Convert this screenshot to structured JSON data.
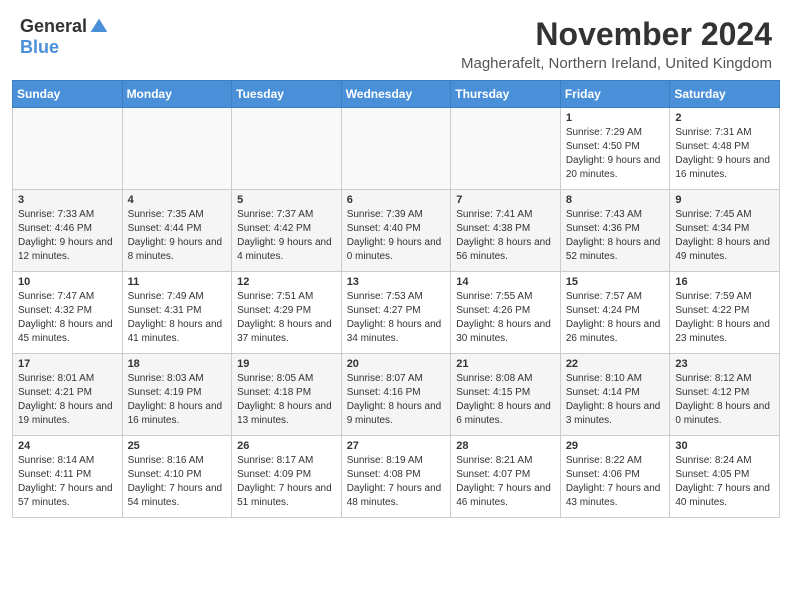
{
  "header": {
    "logo_general": "General",
    "logo_blue": "Blue",
    "month_title": "November 2024",
    "location": "Magherafelt, Northern Ireland, United Kingdom"
  },
  "days_of_week": [
    "Sunday",
    "Monday",
    "Tuesday",
    "Wednesday",
    "Thursday",
    "Friday",
    "Saturday"
  ],
  "weeks": [
    [
      {
        "day": "",
        "info": ""
      },
      {
        "day": "",
        "info": ""
      },
      {
        "day": "",
        "info": ""
      },
      {
        "day": "",
        "info": ""
      },
      {
        "day": "",
        "info": ""
      },
      {
        "day": "1",
        "info": "Sunrise: 7:29 AM\nSunset: 4:50 PM\nDaylight: 9 hours and 20 minutes."
      },
      {
        "day": "2",
        "info": "Sunrise: 7:31 AM\nSunset: 4:48 PM\nDaylight: 9 hours and 16 minutes."
      }
    ],
    [
      {
        "day": "3",
        "info": "Sunrise: 7:33 AM\nSunset: 4:46 PM\nDaylight: 9 hours and 12 minutes."
      },
      {
        "day": "4",
        "info": "Sunrise: 7:35 AM\nSunset: 4:44 PM\nDaylight: 9 hours and 8 minutes."
      },
      {
        "day": "5",
        "info": "Sunrise: 7:37 AM\nSunset: 4:42 PM\nDaylight: 9 hours and 4 minutes."
      },
      {
        "day": "6",
        "info": "Sunrise: 7:39 AM\nSunset: 4:40 PM\nDaylight: 9 hours and 0 minutes."
      },
      {
        "day": "7",
        "info": "Sunrise: 7:41 AM\nSunset: 4:38 PM\nDaylight: 8 hours and 56 minutes."
      },
      {
        "day": "8",
        "info": "Sunrise: 7:43 AM\nSunset: 4:36 PM\nDaylight: 8 hours and 52 minutes."
      },
      {
        "day": "9",
        "info": "Sunrise: 7:45 AM\nSunset: 4:34 PM\nDaylight: 8 hours and 49 minutes."
      }
    ],
    [
      {
        "day": "10",
        "info": "Sunrise: 7:47 AM\nSunset: 4:32 PM\nDaylight: 8 hours and 45 minutes."
      },
      {
        "day": "11",
        "info": "Sunrise: 7:49 AM\nSunset: 4:31 PM\nDaylight: 8 hours and 41 minutes."
      },
      {
        "day": "12",
        "info": "Sunrise: 7:51 AM\nSunset: 4:29 PM\nDaylight: 8 hours and 37 minutes."
      },
      {
        "day": "13",
        "info": "Sunrise: 7:53 AM\nSunset: 4:27 PM\nDaylight: 8 hours and 34 minutes."
      },
      {
        "day": "14",
        "info": "Sunrise: 7:55 AM\nSunset: 4:26 PM\nDaylight: 8 hours and 30 minutes."
      },
      {
        "day": "15",
        "info": "Sunrise: 7:57 AM\nSunset: 4:24 PM\nDaylight: 8 hours and 26 minutes."
      },
      {
        "day": "16",
        "info": "Sunrise: 7:59 AM\nSunset: 4:22 PM\nDaylight: 8 hours and 23 minutes."
      }
    ],
    [
      {
        "day": "17",
        "info": "Sunrise: 8:01 AM\nSunset: 4:21 PM\nDaylight: 8 hours and 19 minutes."
      },
      {
        "day": "18",
        "info": "Sunrise: 8:03 AM\nSunset: 4:19 PM\nDaylight: 8 hours and 16 minutes."
      },
      {
        "day": "19",
        "info": "Sunrise: 8:05 AM\nSunset: 4:18 PM\nDaylight: 8 hours and 13 minutes."
      },
      {
        "day": "20",
        "info": "Sunrise: 8:07 AM\nSunset: 4:16 PM\nDaylight: 8 hours and 9 minutes."
      },
      {
        "day": "21",
        "info": "Sunrise: 8:08 AM\nSunset: 4:15 PM\nDaylight: 8 hours and 6 minutes."
      },
      {
        "day": "22",
        "info": "Sunrise: 8:10 AM\nSunset: 4:14 PM\nDaylight: 8 hours and 3 minutes."
      },
      {
        "day": "23",
        "info": "Sunrise: 8:12 AM\nSunset: 4:12 PM\nDaylight: 8 hours and 0 minutes."
      }
    ],
    [
      {
        "day": "24",
        "info": "Sunrise: 8:14 AM\nSunset: 4:11 PM\nDaylight: 7 hours and 57 minutes."
      },
      {
        "day": "25",
        "info": "Sunrise: 8:16 AM\nSunset: 4:10 PM\nDaylight: 7 hours and 54 minutes."
      },
      {
        "day": "26",
        "info": "Sunrise: 8:17 AM\nSunset: 4:09 PM\nDaylight: 7 hours and 51 minutes."
      },
      {
        "day": "27",
        "info": "Sunrise: 8:19 AM\nSunset: 4:08 PM\nDaylight: 7 hours and 48 minutes."
      },
      {
        "day": "28",
        "info": "Sunrise: 8:21 AM\nSunset: 4:07 PM\nDaylight: 7 hours and 46 minutes."
      },
      {
        "day": "29",
        "info": "Sunrise: 8:22 AM\nSunset: 4:06 PM\nDaylight: 7 hours and 43 minutes."
      },
      {
        "day": "30",
        "info": "Sunrise: 8:24 AM\nSunset: 4:05 PM\nDaylight: 7 hours and 40 minutes."
      }
    ]
  ]
}
